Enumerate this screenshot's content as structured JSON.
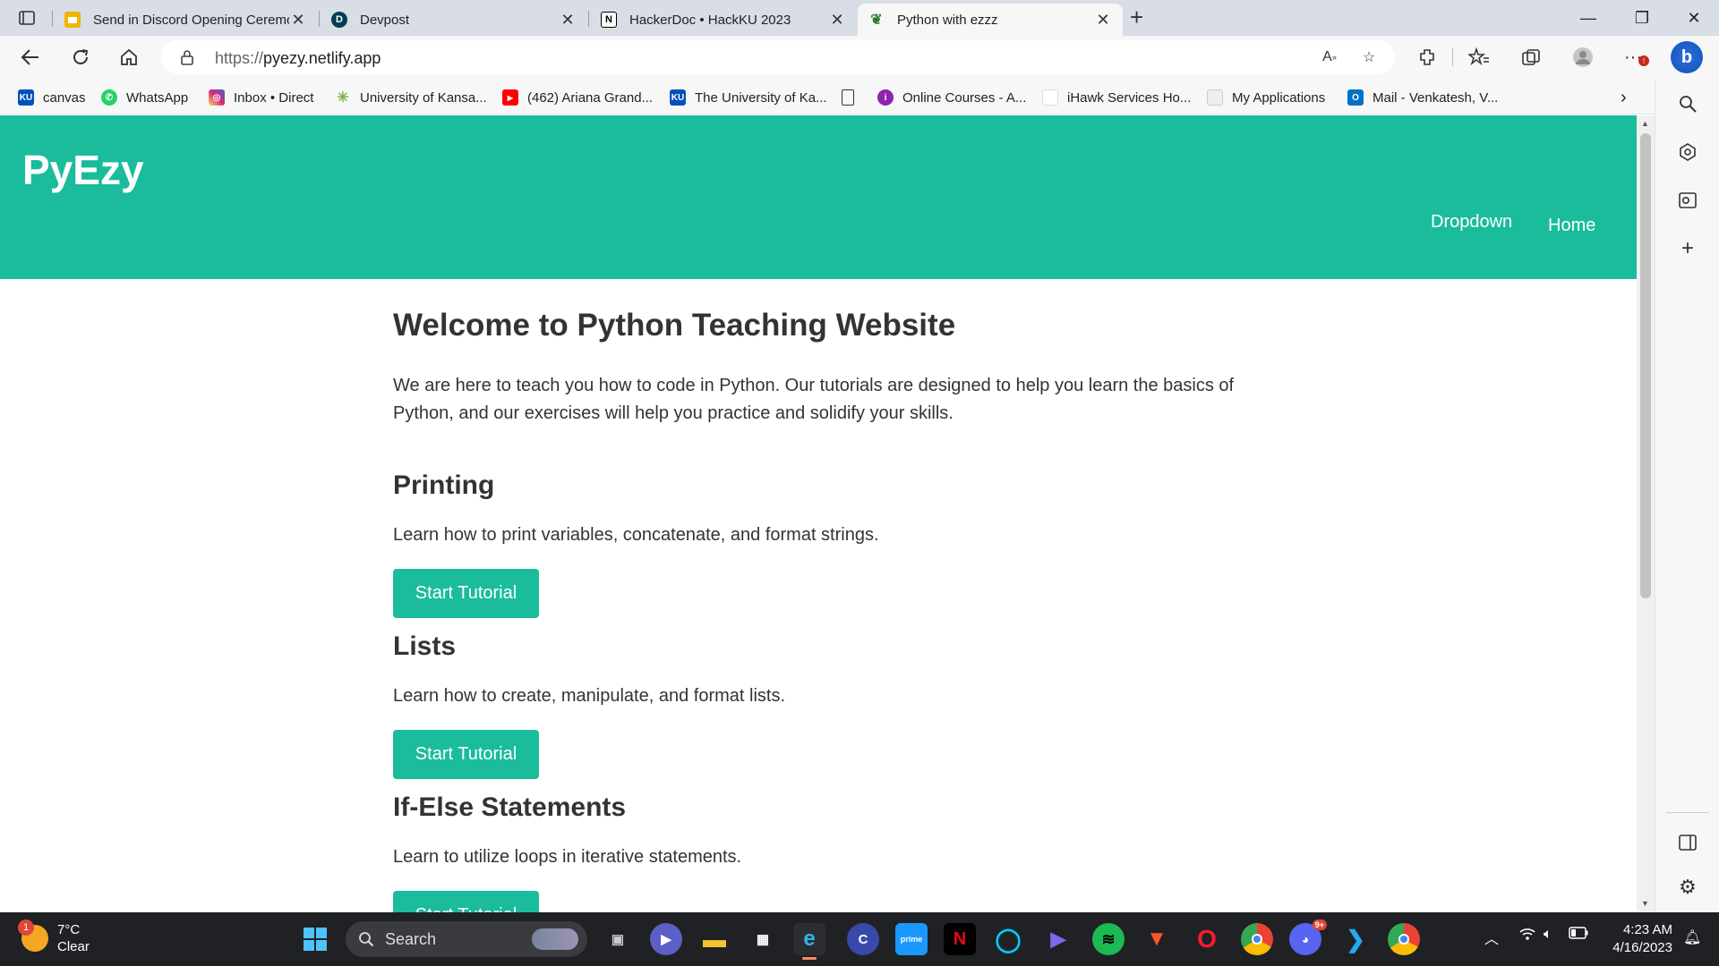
{
  "browser": {
    "tabs": [
      {
        "title": "Send in Discord Opening Ceremo",
        "favicon": "slides-icon",
        "color": "#f4b400"
      },
      {
        "title": "Devpost",
        "favicon": "devpost-icon",
        "color": "#003e54"
      },
      {
        "title": "HackerDoc • HackKU 2023",
        "favicon": "notion-icon",
        "color": "#000000"
      },
      {
        "title": "Python with ezzz",
        "favicon": "pyezy-icon",
        "color": "#2e7d32",
        "active": true
      }
    ],
    "url_protocol": "https://",
    "url_host": "pyezy.netlify.app",
    "bookmarks": [
      {
        "label": "canvas",
        "icon": "KU",
        "color": "#0051ba"
      },
      {
        "label": "WhatsApp",
        "icon": "W",
        "color": "#25d366"
      },
      {
        "label": "Inbox • Direct",
        "icon": "IG",
        "color": "#d62976"
      },
      {
        "label": "University of Kansa...",
        "icon": "*",
        "color": "#7cb342"
      },
      {
        "label": "(462) Ariana Grand...",
        "icon": "▶",
        "color": "#ff0000"
      },
      {
        "label": "The University of Ka...",
        "icon": "KU",
        "color": "#0051ba"
      },
      {
        "label": "",
        "icon": "",
        "color": "#ffffff"
      },
      {
        "label": "Online Courses - A...",
        "icon": "i",
        "color": "#8e24aa"
      },
      {
        "label": "iHawk Services Ho...",
        "icon": "",
        "color": "#ffffff"
      },
      {
        "label": "My Applications",
        "icon": "",
        "color": "#dddddd"
      },
      {
        "label": "Mail - Venkatesh, V...",
        "icon": "O",
        "color": "#0072c6"
      }
    ]
  },
  "site": {
    "logo": "PyEzy",
    "nav": [
      "Dropdown",
      "Home"
    ],
    "accent": "#1abc9c",
    "heading": "Welcome to Python Teaching Website",
    "intro": "We are here to teach you how to code in Python. Our tutorials are designed to help you learn the basics of Python, and our exercises will help you practice and solidify your skills.",
    "sections": [
      {
        "title": "Printing",
        "desc": "Learn how to print variables, concatenate, and format strings.",
        "button": "Start Tutorial"
      },
      {
        "title": "Lists",
        "desc": "Learn how to create, manipulate, and format lists.",
        "button": "Start Tutorial"
      },
      {
        "title": "If-Else Statements",
        "desc": "Learn to utilize loops in iterative statements.",
        "button": "Start Tutorial"
      }
    ]
  },
  "taskbar": {
    "weather_badge": "1",
    "temperature": "7°C",
    "condition": "Clear",
    "search_label": "Search",
    "time": "4:23 AM",
    "date": "4/16/2023"
  }
}
